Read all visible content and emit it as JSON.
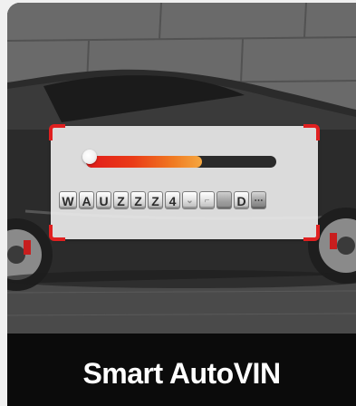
{
  "scanner": {
    "progress": 0.61,
    "vin_chars": [
      "W",
      "A",
      "U",
      "Z",
      "Z",
      "Z",
      "4",
      "⌄",
      "⌐",
      "",
      "D",
      "⋯"
    ]
  },
  "footer": {
    "title": "Smart AutoVIN"
  },
  "colors": {
    "accent_red": "#e02020",
    "progress_start": "#e11b1b",
    "progress_end": "#f5a740",
    "footer_bg": "#0b0b0b"
  }
}
